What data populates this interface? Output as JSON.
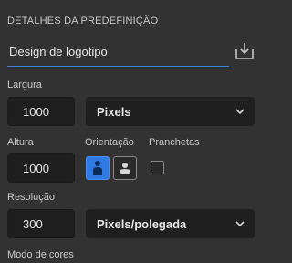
{
  "panel": {
    "section_title": "DETALHES DA PREDEFINIÇÃO",
    "preset_name": "Design de logotipo",
    "save_icon": "save-preset-icon"
  },
  "width": {
    "label": "Largura",
    "value": "1000",
    "unit": "Pixels"
  },
  "height": {
    "label": "Altura",
    "value": "1000"
  },
  "orientation": {
    "label": "Orientação",
    "selected": "portrait"
  },
  "artboards": {
    "label": "Pranchetas",
    "checked": false
  },
  "resolution": {
    "label": "Resolução",
    "value": "300",
    "unit": "Pixels/polegada"
  },
  "color_mode": {
    "label": "Modo de cores"
  },
  "colors": {
    "accent": "#2f7ae5",
    "underline": "#3f7fd0",
    "background": "#323232",
    "field": "#1e1e1e"
  }
}
